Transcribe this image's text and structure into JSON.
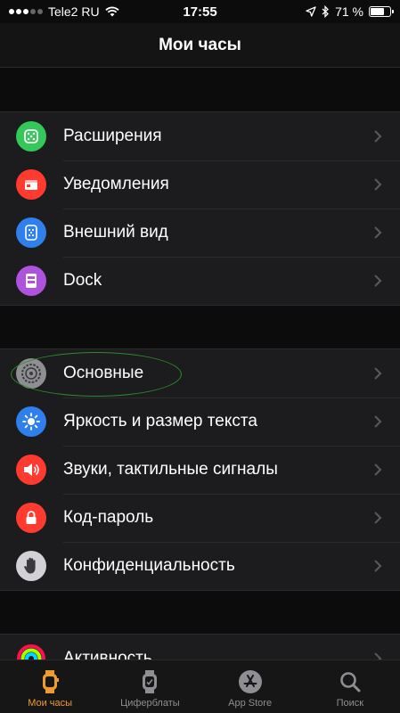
{
  "status": {
    "carrier": "Tele2 RU",
    "time": "17:55",
    "battery_text": "71 %",
    "battery_level": 0.71
  },
  "header": {
    "title": "Мои часы"
  },
  "groups": [
    {
      "items": [
        {
          "label": "Расширения",
          "icon": "complications-icon",
          "color": "#34c759"
        },
        {
          "label": "Уведомления",
          "icon": "notifications-icon",
          "color": "#ff3b30"
        },
        {
          "label": "Внешний вид",
          "icon": "app-view-icon",
          "color": "#2f80ed"
        },
        {
          "label": "Dock",
          "icon": "dock-icon",
          "color": "#af52de"
        }
      ]
    },
    {
      "items": [
        {
          "label": "Основные",
          "icon": "gear-icon",
          "color": "#8e8e93"
        },
        {
          "label": "Яркость и размер текста",
          "icon": "brightness-icon",
          "color": "#2f80ed"
        },
        {
          "label": "Звуки, тактильные сигналы",
          "icon": "speaker-icon",
          "color": "#ff3b30"
        },
        {
          "label": "Код-пароль",
          "icon": "lock-icon",
          "color": "#ff3b30"
        },
        {
          "label": "Конфиденциальность",
          "icon": "hand-icon",
          "color": "#d1d1d6"
        }
      ]
    },
    {
      "items": [
        {
          "label": "Активность",
          "icon": "activity-rings-icon",
          "color": "#1c1c1e"
        }
      ]
    }
  ],
  "tabs": [
    {
      "label": "Мои часы",
      "icon": "watch-icon",
      "active": true
    },
    {
      "label": "Циферблаты",
      "icon": "watch-face-icon",
      "active": false
    },
    {
      "label": "App Store",
      "icon": "app-store-icon",
      "active": false
    },
    {
      "label": "Поиск",
      "icon": "search-icon",
      "active": false
    }
  ]
}
